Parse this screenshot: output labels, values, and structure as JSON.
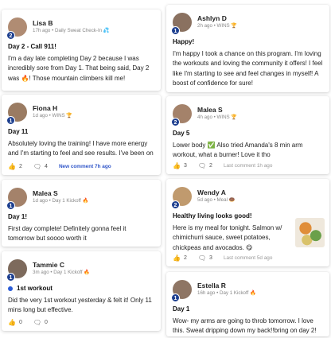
{
  "left": [
    {
      "name": "Lisa B",
      "sub": "17h ago • Daily Sweat Check-In 💦",
      "level": "2",
      "avatar_color": "#b08c73",
      "title": "Day 2 - Call 911!",
      "text": "I'm a day late completing Day 2 because I was incredibly sore from Day 1. That being said, Day 2 was 🔥! Those mountain climbers kill me!",
      "likes": "",
      "comments": "",
      "last": ""
    },
    {
      "name": "Fiona H",
      "sub": "1d ago • WINS 🏆",
      "level": "1",
      "avatar_color": "#9a7b62",
      "title": "Day 11",
      "text": "Absolutely loving the training! I have more energy and I'm starting to feel and see results. I've been on",
      "likes": "2",
      "comments": "4",
      "last": "New comment 7h ago"
    },
    {
      "name": "Malea S",
      "sub": "1d ago • Day 1 Kickoff 🔥",
      "level": "1",
      "avatar_color": "#a4826a",
      "title": "Day 1!",
      "text": "First day complete! Definitely gonna feel it tomorrow but soooo worth it",
      "likes": "",
      "comments": "",
      "last": ""
    },
    {
      "name": "Tammie C",
      "sub": "3m ago • Day 1 Kickoff 🔥",
      "level": "1",
      "avatar_color": "#7d6a5c",
      "title": "1st workout",
      "text": "Did the very 1st workout yesterday & felt it! Only 11 mins long but effective.",
      "likes": "0",
      "comments": "0",
      "last": ""
    }
  ],
  "right": [
    {
      "name": "Ashlyn D",
      "sub": "2h ago • WINS 🏆",
      "level": "1",
      "avatar_color": "#8a7160",
      "title": "Happy!",
      "text": "I'm happy I took a chance on this program. I'm loving the workouts and loving the community it offers! I feel like I'm starting to see and feel changes in myself! A boost of confidence for sure!",
      "likes": "",
      "comments": "",
      "last": ""
    },
    {
      "name": "Malea S",
      "sub": "4h ago • WINS 🏆",
      "level": "2",
      "avatar_color": "#a4826a",
      "title": "Day 5",
      "text": "Lower body ✅ Also tried Amanda's 8 min arm workout, what a burner! Love it tho",
      "likes": "3",
      "comments": "2",
      "last": "Last comment 1h ago"
    },
    {
      "name": "Wendy A",
      "sub": "5d ago • Meal 🍩",
      "level": "2",
      "avatar_color": "#c09a6e",
      "title": "Healthy living looks good!",
      "text": "Here is my meal for tonight. Salmon w/ chimichurri sauce, sweet potatoes, chickpeas and avocados. 😋",
      "likes": "2",
      "comments": "3",
      "last": "Last comment 5d ago"
    },
    {
      "name": "Estella R",
      "sub": "16h ago • Day 1 Kickoff 🔥",
      "level": "1",
      "avatar_color": "#8e7564",
      "title": "Day 1",
      "text": "Wow- my arms are going to throb tomorrow. I love this. Sweat dripping down my back!!bring on day 2!",
      "likes": "",
      "comments": "",
      "last": ""
    }
  ],
  "icons": {
    "like": "thumbs-up-icon",
    "comment": "comment-icon"
  }
}
